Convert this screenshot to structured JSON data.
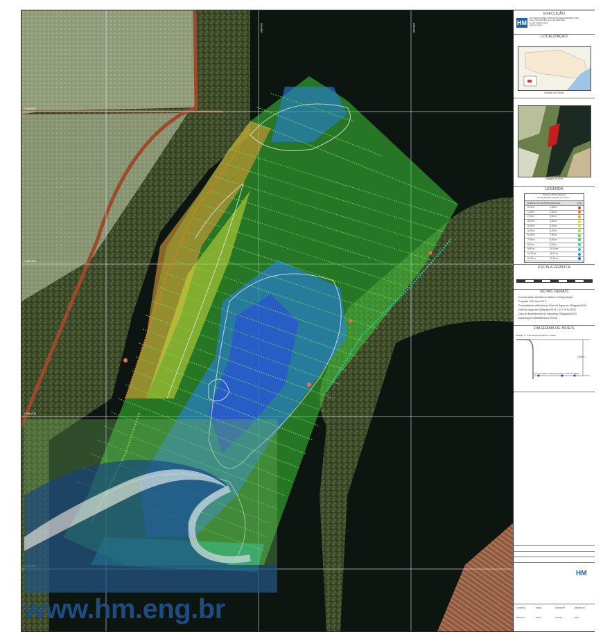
{
  "panel": {
    "execution_title": "EXECUÇÃO",
    "company_logo": "HM",
    "company_lines": [
      "HM CONSULTORES E PROJETOS DE ENGENHARIA LTDA",
      "Fone: (00) 0000-0000 / Fax: (00) 0000-0000",
      "E-mail: hm@hm.eng.br",
      "www.hm.eng.br"
    ],
    "location_title": "LOCALIZAÇÃO",
    "location_caption": "Posição no Estado",
    "aerial_caption": "Imagem da Área",
    "legend_title": "LEGENDA",
    "legend_header_lines": [
      "Tabela de Profundidades",
      "Profundidades referidas ao NA em..."
    ],
    "legend_columns": [
      "INTERVALOS DE PROFUNDIDADE",
      "COR"
    ],
    "legend_rows": [
      {
        "from": "0,00 m",
        "to": "1,00 m",
        "color": "#e63a1a"
      },
      {
        "from": "1,00 m",
        "to": "2,00 m",
        "color": "#f07a1a"
      },
      {
        "from": "2,00 m",
        "to": "3,00 m",
        "color": "#f5a623"
      },
      {
        "from": "3,00 m",
        "to": "4,00 m",
        "color": "#f2d12a"
      },
      {
        "from": "4,00 m",
        "to": "5,00 m",
        "color": "#d4e637"
      },
      {
        "from": "5,00 m",
        "to": "6,00 m",
        "color": "#9be63a"
      },
      {
        "from": "6,00 m",
        "to": "7,00 m",
        "color": "#4cdb3c"
      },
      {
        "from": "7,00 m",
        "to": "8,00 m",
        "color": "#2bd66a"
      },
      {
        "from": "8,00 m",
        "to": "9,00 m",
        "color": "#27d1b0"
      },
      {
        "from": "9,00 m",
        "to": "10,00 m",
        "color": "#26b8e0"
      },
      {
        "from": "10,00 m",
        "to": "11,00 m",
        "color": "#2a86e6"
      },
      {
        "from": "11,00 m",
        "to": "12,00 m",
        "color": "#2d55e0"
      }
    ],
    "scale_title": "ESCALA GRÁFICA",
    "notes_title": "NOTAS GERAIS",
    "notes": [
      "Coordenadas referidas ao Datum Córrego Alegre",
      "Projeção UTM Zona 22 S",
      "Profundidades referidas ao Nível de Água em 05/agosto/2013",
      "Nível de Água em 05/agosto/2013 = 427,79 m IBGE",
      "Data do levantamento de batimetria: 05/agosto/2013",
      "Autorização CHM/Marinha 27/2013"
    ],
    "diagram_title": "DIAGRAMA DE NÍVEIS",
    "diagram_top_label": "Estação 1 - Cota da Régua 430,51 m IBGE",
    "diagram_value": "2,65 m",
    "diagram_bottom_label": "Nível de Água em 05/agosto/2013 = 427,79 m IBGE",
    "title_block_logo": "HM",
    "title_block_labels": [
      "CLIENTE",
      "OBRA",
      "ASSUNTO",
      "DESENHO",
      "ESCALA",
      "DATA",
      "FOLHA",
      "REV"
    ]
  },
  "map": {
    "watermark_url": "www.hm.eng.br",
    "grid_labels": [
      "7.466.800",
      "7.466.400",
      "7.466.000",
      "7.465.600",
      "264.800",
      "265.200"
    ]
  }
}
